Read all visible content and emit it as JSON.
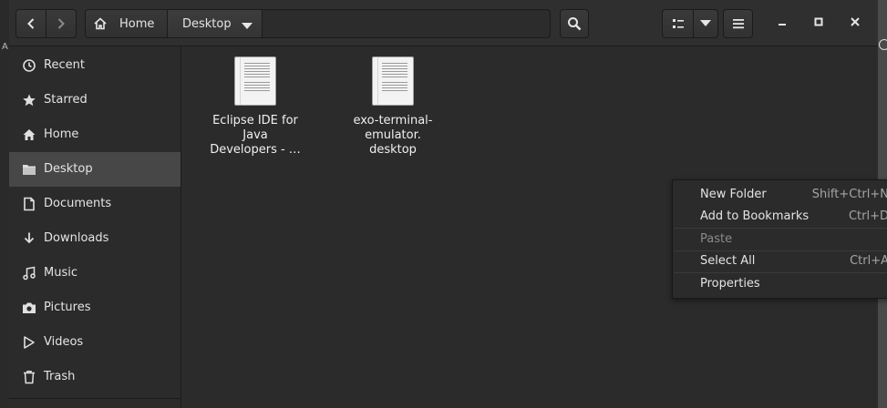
{
  "nav": {
    "back_icon": "chevron-left-icon",
    "forward_icon": "chevron-right-icon"
  },
  "pathbar": {
    "home_label": "Home",
    "current_label": "Desktop",
    "home_icon": "home-icon",
    "dropdown_icon": "triangle-down-icon"
  },
  "toolbar": {
    "search_icon": "search-icon",
    "view_icon": "list-view-icon",
    "view_dropdown_icon": "triangle-down-icon",
    "menu_icon": "hamburger-icon"
  },
  "window_controls": {
    "minimize_icon": "minimize-icon",
    "maximize_icon": "maximize-icon",
    "close_icon": "close-icon"
  },
  "sidebar": {
    "items": [
      {
        "label": "Recent",
        "icon": "clock-icon"
      },
      {
        "label": "Starred",
        "icon": "star-icon"
      },
      {
        "label": "Home",
        "icon": "home-icon"
      },
      {
        "label": "Desktop",
        "icon": "folder-icon",
        "selected": true
      },
      {
        "label": "Documents",
        "icon": "document-icon"
      },
      {
        "label": "Downloads",
        "icon": "download-icon"
      },
      {
        "label": "Music",
        "icon": "music-icon"
      },
      {
        "label": "Pictures",
        "icon": "camera-icon"
      },
      {
        "label": "Videos",
        "icon": "film-icon"
      },
      {
        "label": "Trash",
        "icon": "trash-icon"
      }
    ]
  },
  "files": [
    {
      "name_lines": [
        "Eclipse IDE for",
        "Java",
        "Developers - …"
      ],
      "icon": "text-file-icon"
    },
    {
      "name_lines": [
        "exo-terminal-",
        "emulator.",
        "desktop"
      ],
      "icon": "text-file-icon"
    }
  ],
  "context_menu": {
    "items": [
      {
        "label": "New Folder",
        "accel": "Shift+Ctrl+N",
        "enabled": true
      },
      {
        "label": "Add to Bookmarks",
        "accel": "Ctrl+D",
        "enabled": true
      },
      {
        "label": "Paste",
        "accel": "",
        "enabled": false
      },
      {
        "label": "Select All",
        "accel": "Ctrl+A",
        "enabled": true
      },
      {
        "label": "Properties",
        "accel": "",
        "enabled": true
      }
    ]
  }
}
